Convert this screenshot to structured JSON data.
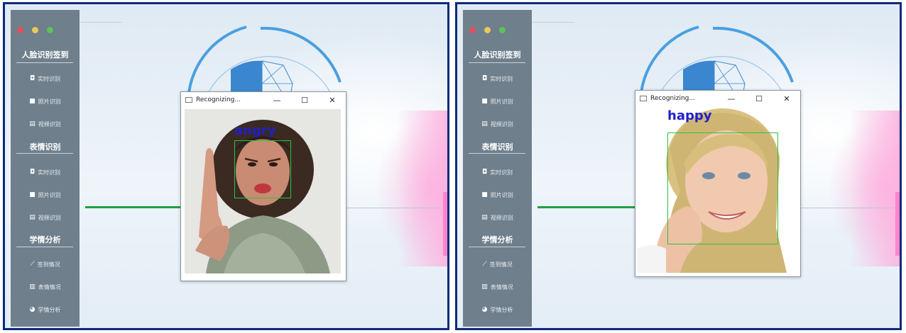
{
  "screens": [
    {
      "sidebar": {
        "sections": [
          {
            "title": "人脸识别签到",
            "items": [
              {
                "icon": "camera-icon",
                "glyph": "◘",
                "label": "实时识别"
              },
              {
                "icon": "folder-icon",
                "glyph": "■",
                "label": "照片识别"
              },
              {
                "icon": "film-icon",
                "glyph": "▤",
                "label": "视频识别"
              }
            ]
          },
          {
            "title": "表情识别",
            "items": [
              {
                "icon": "camera-icon",
                "glyph": "◘",
                "label": "实时识别"
              },
              {
                "icon": "folder-icon",
                "glyph": "■",
                "label": "照片识别"
              },
              {
                "icon": "film-icon",
                "glyph": "▤",
                "label": "视频识别"
              }
            ]
          },
          {
            "title": "学情分析",
            "items": [
              {
                "icon": "line-chart-icon",
                "glyph": "⟋",
                "label": "签到情况"
              },
              {
                "icon": "bar-chart-icon",
                "glyph": "▥",
                "label": "表情情况"
              },
              {
                "icon": "pie-chart-icon",
                "glyph": "◕",
                "label": "学情分析"
              }
            ]
          }
        ]
      },
      "window": {
        "title": "Recognizing...",
        "minimize": "—",
        "maximize": "☐",
        "close": "✕"
      },
      "emotion_label": "angry"
    },
    {
      "sidebar": {
        "sections": [
          {
            "title": "人脸识别签到",
            "items": [
              {
                "icon": "camera-icon",
                "glyph": "◘",
                "label": "实时识别"
              },
              {
                "icon": "folder-icon",
                "glyph": "■",
                "label": "照片识别"
              },
              {
                "icon": "film-icon",
                "glyph": "▤",
                "label": "视频识别"
              }
            ]
          },
          {
            "title": "表情识别",
            "items": [
              {
                "icon": "camera-icon",
                "glyph": "◘",
                "label": "实时识别"
              },
              {
                "icon": "folder-icon",
                "glyph": "■",
                "label": "照片识别"
              },
              {
                "icon": "film-icon",
                "glyph": "▤",
                "label": "视频识别"
              }
            ]
          },
          {
            "title": "学情分析",
            "items": [
              {
                "icon": "line-chart-icon",
                "glyph": "⟋",
                "label": "签到情况"
              },
              {
                "icon": "bar-chart-icon",
                "glyph": "▥",
                "label": "表情情况"
              },
              {
                "icon": "pie-chart-icon",
                "glyph": "◕",
                "label": "学情分析"
              }
            ]
          }
        ]
      },
      "window": {
        "title": "Recognizing...",
        "minimize": "—",
        "maximize": "☐",
        "close": "✕"
      },
      "emotion_label": "happy"
    }
  ],
  "colors": {
    "sidebar": "#6f7f8c",
    "frame": "#0d2a7a",
    "emotion_text": "#2020c8",
    "face_box": "#29c43a",
    "divider_green": "#1fa23e"
  }
}
